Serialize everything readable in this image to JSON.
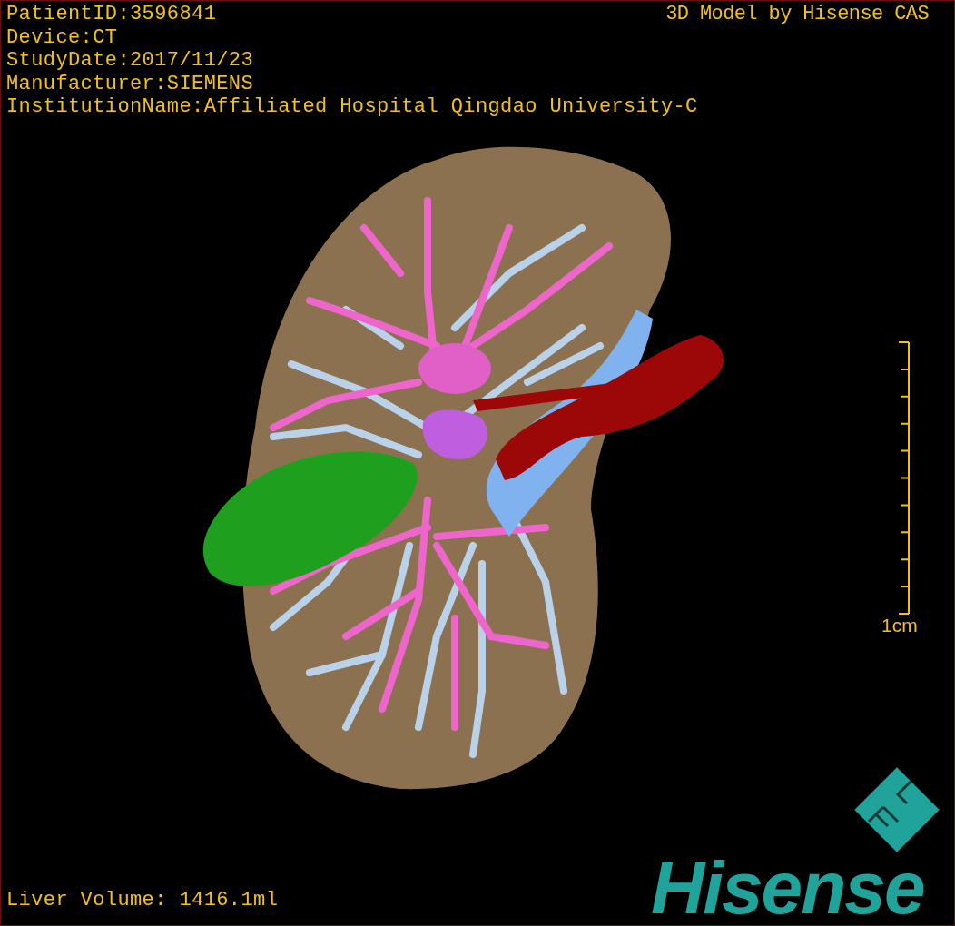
{
  "viewport": {
    "patient_info": [
      "PatientID:3596841",
      "Device:CT",
      "StudyDate:2017/11/23",
      "Manufacturer:SIEMENS",
      "InstitutionName:Affiliated Hospital Qingdao University-C"
    ],
    "model_caption": "3D Model by Hisense CAS",
    "scale_bar": {
      "label": "1cm"
    },
    "liver_volume": "Liver Volume: 1416.1ml",
    "logo": {
      "wordmark": "Hisense"
    }
  }
}
